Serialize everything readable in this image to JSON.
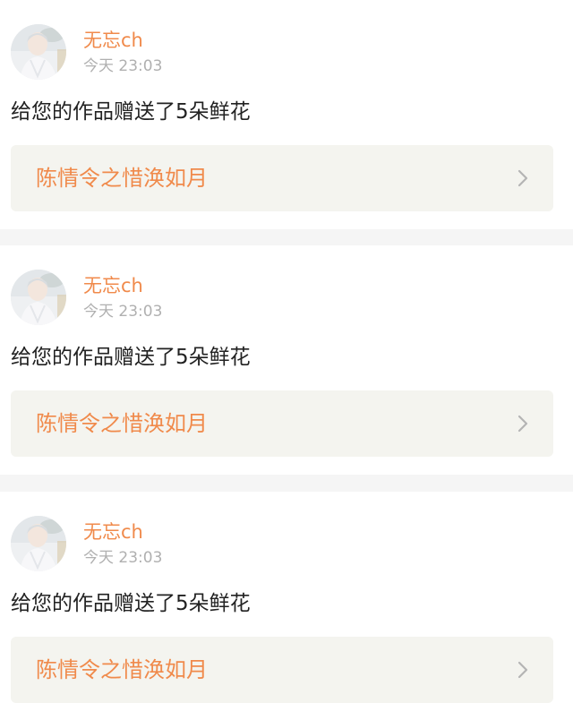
{
  "notifications": [
    {
      "username": "无忘ch",
      "time": "今天 23:03",
      "message": "给您的作品赠送了5朵鲜花",
      "work_title": "陈情令之惜涣如月",
      "avatar_icon": "user-avatar"
    },
    {
      "username": "无忘ch",
      "time": "今天 23:03",
      "message": "给您的作品赠送了5朵鲜花",
      "work_title": "陈情令之惜涣如月",
      "avatar_icon": "user-avatar"
    },
    {
      "username": "无忘ch",
      "time": "今天 23:03",
      "message": "给您的作品赠送了5朵鲜花",
      "work_title": "陈情令之惜涣如月",
      "avatar_icon": "user-avatar"
    }
  ],
  "colors": {
    "accent": "#f08a4b",
    "timestamp": "#b0b0b0",
    "message_text": "#222222",
    "link_background": "#f4f4ef",
    "page_background": "#f5f5f5",
    "card_background": "#ffffff"
  }
}
